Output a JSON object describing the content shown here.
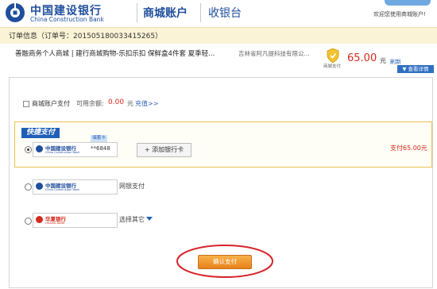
{
  "header": {
    "bank_name_cn": "中国建设银行",
    "bank_name_en": "China Construction Bank",
    "mall_account": "商城账户",
    "cashier": "收银台",
    "welcome": "欢迎您使用商城账户!"
  },
  "order": {
    "info": "订单信息（订单号：20150518003341​5265）",
    "description": "善融商务个人商城 | 建行商城购物-乐扣乐扣 保鲜盒4件套 夏季轻...",
    "merchant": "吉林省阿凡提科技有限公...",
    "shield_label": "商城支付",
    "amount": "65.00",
    "amount_unit": "元",
    "refresh": "刷新",
    "details_label": "▼ 查看详情"
  },
  "mall_account_pay": {
    "label": "商城账户支付",
    "balance_label": "可用余额:",
    "balance_value": "0.00",
    "balance_unit": "元",
    "recharge": "充值>>"
  },
  "quick_pay": {
    "logo": "快捷支付",
    "card_tag": "储蓄卡",
    "card_number": "**6848",
    "add_card": "+ 添加银行卡",
    "pay_amount": "支付65.00元",
    "bank_cn": "中国建设银行",
    "bank_en": "China Construction Bank"
  },
  "other_banks": {
    "netbank_label": "网银支付",
    "ccb_cn": "中国建设银行",
    "ccb_en": "China Construction Bank",
    "hx_cn": "华夏银行",
    "hx_en": "HUAXIA BANK",
    "other_label": "选择其它"
  },
  "confirm": {
    "label": "确认支付"
  },
  "colors": {
    "brand_blue": "#1f4e9c",
    "price_red": "#d42a1b",
    "confirm_orange": "#e8821c",
    "highlight_red": "#d8232a"
  }
}
